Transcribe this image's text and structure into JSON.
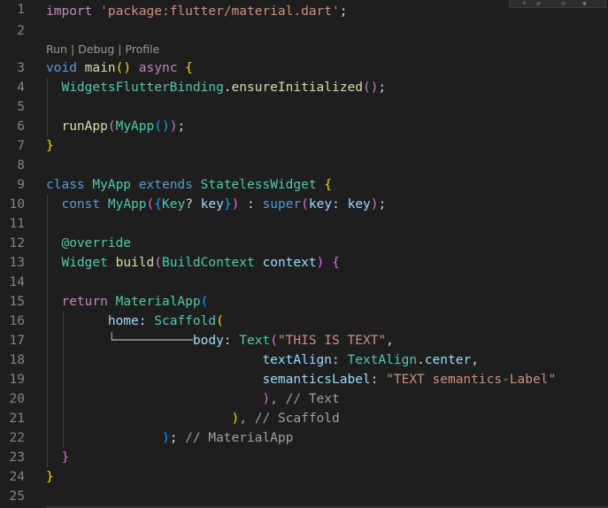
{
  "editor": {
    "line_numbers": [
      "1",
      "2",
      "3",
      "4",
      "5",
      "6",
      "7",
      "8",
      "9",
      "10",
      "11",
      "12",
      "13",
      "14",
      "15",
      "16",
      "17",
      "18",
      "19",
      "20",
      "21",
      "22",
      "23",
      "24",
      "25"
    ],
    "codelens": {
      "run": "Run",
      "debug": "Debug",
      "profile": "Profile",
      "separator": " | "
    },
    "lines": {
      "l1": {
        "kw": "import",
        "str": "'package:flutter/material.dart'",
        "end": ";"
      },
      "l3": {
        "type": "void",
        "fn": "main",
        "p_open": "(",
        "p_close": ")",
        "async": "async",
        "brace": "{"
      },
      "l4": {
        "cls": "WidgetsFlutterBinding",
        "dot": ".",
        "fn": "ensureInitialized",
        "p_open": "(",
        "p_close": ")",
        "end": ";"
      },
      "l6": {
        "fn": "runApp",
        "p_open": "(",
        "cls": "MyApp",
        "p2_open": "(",
        "p2_close": ")",
        "p_close": ")",
        "end": ";"
      },
      "l7": {
        "brace": "}"
      },
      "l9": {
        "kw": "class",
        "cls": "MyApp",
        "kw2": "extends",
        "cls2": "StatelessWidget",
        "brace": "{"
      },
      "l10": {
        "kw": "const",
        "cls": "MyApp",
        "p_open": "(",
        "b_open": "{",
        "type": "Key",
        "q": "? ",
        "param": "key",
        "b_close": "}",
        "p_close": ")",
        "colon": " : ",
        "sup": "super",
        "p2_open": "(",
        "named": "key",
        "c": ": ",
        "arg": "key",
        "p2_close": ")",
        "end": ";"
      },
      "l12": {
        "annot": "@override"
      },
      "l13": {
        "type": "Widget",
        "fn": "build",
        "p_open": "(",
        "type2": "BuildContext",
        "param": "context",
        "p_close": ")",
        "brace": "{"
      },
      "l15": {
        "kw": "return",
        "cls": "MaterialApp",
        "p_open": "("
      },
      "l16": {
        "named": "home",
        "c": ": ",
        "cls": "Scaffold",
        "p_open": "("
      },
      "l17": {
        "tree": "└──────────",
        "named": "body",
        "c": ": ",
        "cls": "Text",
        "p_open": "(",
        "str": "\"THIS IS TEXT\"",
        "comma": ","
      },
      "l18": {
        "named": "textAlign",
        "c": ": ",
        "cls": "TextAlign",
        "dot": ".",
        "val": "center",
        "comma": ","
      },
      "l19": {
        "named": "semanticsLabel",
        "c": ": ",
        "str": "\"TEXT semantics-Label\""
      },
      "l20": {
        "p_close": ")",
        "comment": ", // Text"
      },
      "l21": {
        "p_close": ")",
        "comment": ", // Scaffold"
      },
      "l22": {
        "p_close": ")",
        "semi": ";",
        "comment": " // MaterialApp"
      },
      "l23": {
        "brace": "}"
      },
      "l24": {
        "brace": "}"
      }
    },
    "colors": {
      "background": "#1e1e1e",
      "keyword": "#569cd6",
      "control": "#c586c0",
      "string": "#ce9178",
      "function": "#dcdcaa",
      "type": "#4ec9b0",
      "variable": "#9cdcfe",
      "line_number": "#858585"
    }
  }
}
